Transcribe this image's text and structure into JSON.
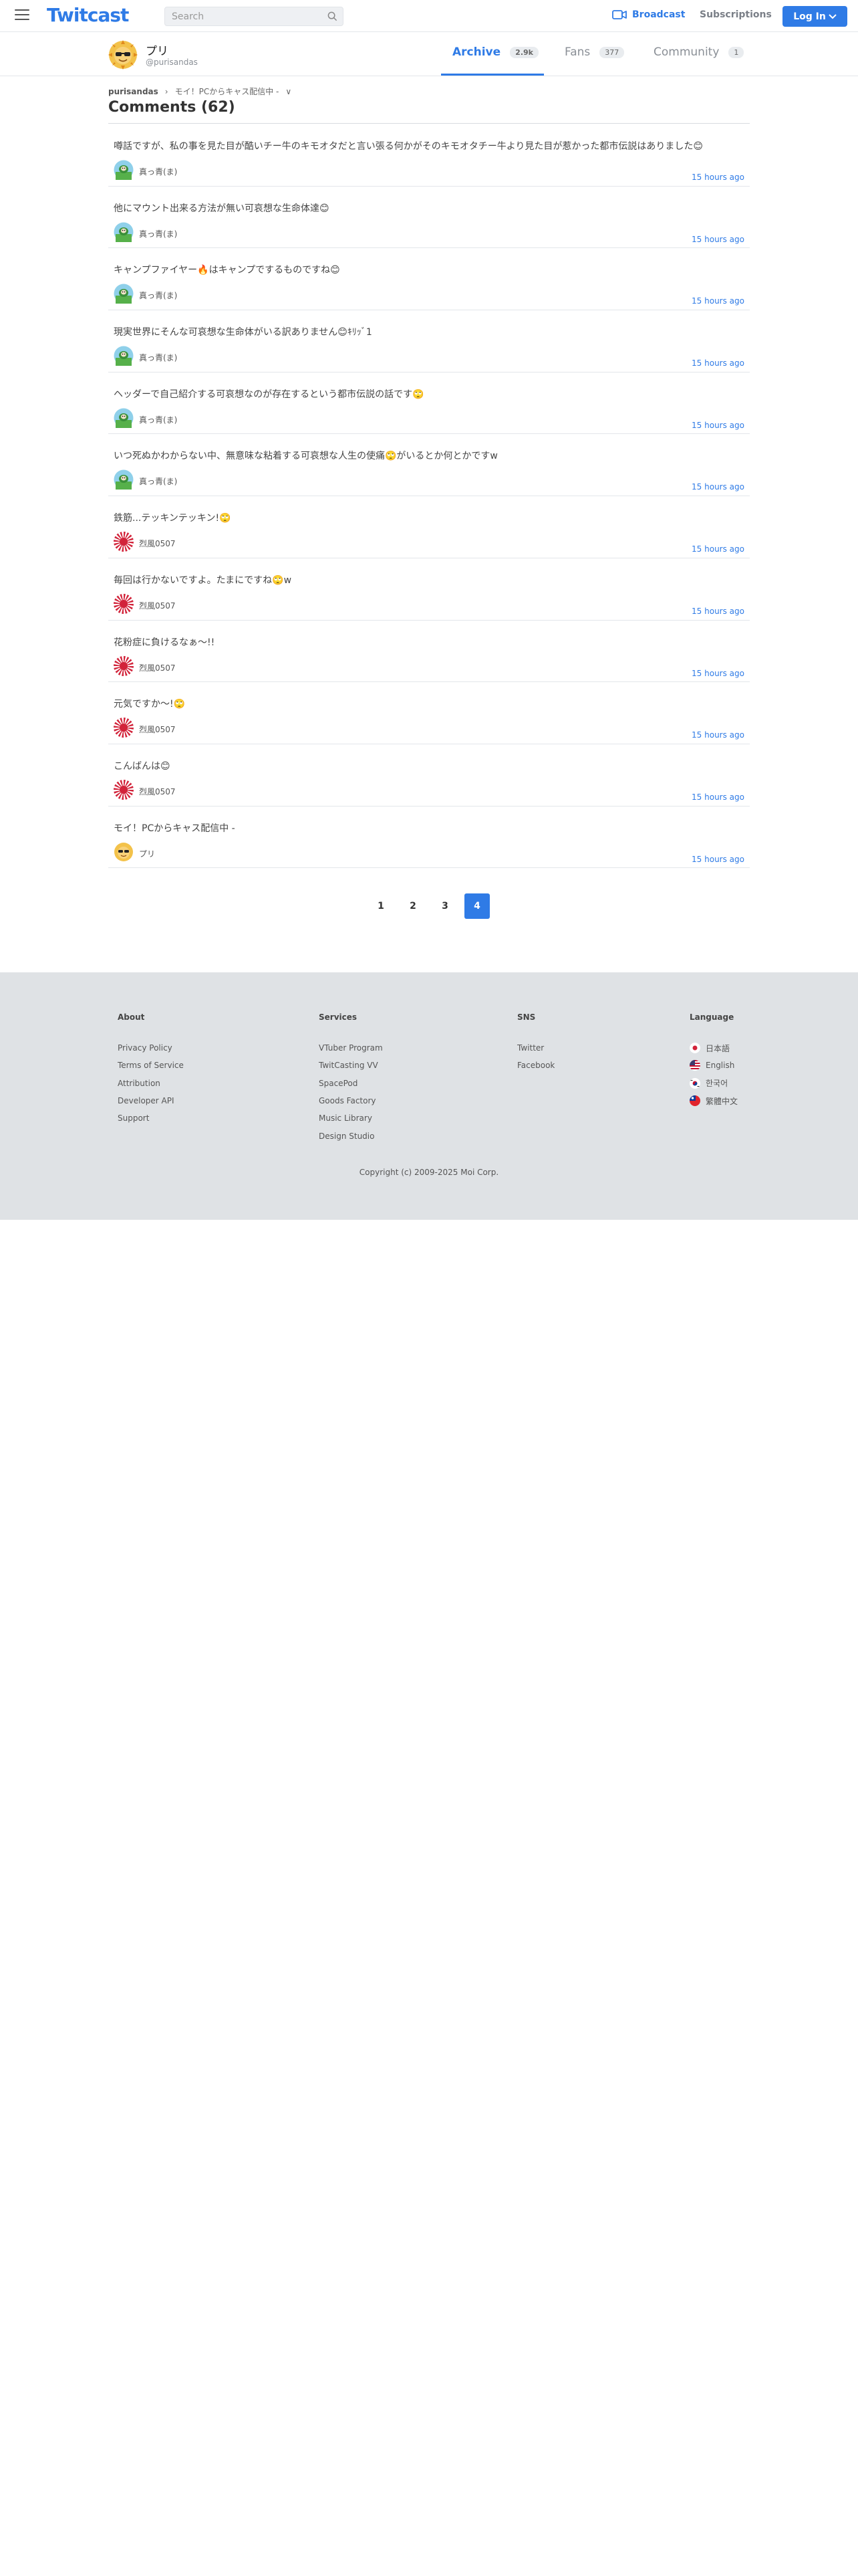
{
  "header": {
    "logo": "Twitcast",
    "search_placeholder": "Search",
    "broadcast_label": "Broadcast",
    "subscriptions_label": "Subscriptions",
    "login_label": "Log In"
  },
  "profile": {
    "name": "プリ",
    "handle": "@purisandas",
    "tabs": [
      {
        "label": "Archive",
        "count": "2.9k"
      },
      {
        "label": "Fans",
        "count": "377"
      },
      {
        "label": "Community",
        "count": "1"
      }
    ]
  },
  "breadcrumb": {
    "user": "purisandas",
    "separator": "›",
    "movie": "モイ！PCからキャス配信中 -",
    "chevron": "∨"
  },
  "page_title": "Comments (62)",
  "comments": [
    {
      "text": "噂話ですが、私の事を見た目が酷いチー牛のキモオタだと言い張る何かがそのキモオタチー牛より見た目が惹かった都市伝説はありました😊",
      "user": "真っ青(ま)",
      "time": "15 hours ago",
      "avatar": "blue"
    },
    {
      "text": "他にマウント出来る方法が無い可哀想な生命体達😊",
      "user": "真っ青(ま)",
      "time": "15 hours ago",
      "avatar": "blue"
    },
    {
      "text": "キャンプファイヤー🔥はキャンプでするものですね😊",
      "user": "真っ青(ま)",
      "time": "15 hours ago",
      "avatar": "blue"
    },
    {
      "text": "現実世界にそんな可哀想な生命体がいる訳ありません😊ｷﾘｯﾞ1",
      "user": "真っ青(ま)",
      "time": "15 hours ago",
      "avatar": "blue"
    },
    {
      "text": "ヘッダーで自己紹介する可哀想なのが存在するという都市伝説の話です🙄",
      "user": "真っ青(ま)",
      "time": "15 hours ago",
      "avatar": "blue"
    },
    {
      "text": "いつ死ぬかわからない中、無意味な粘着する可哀想な人生の使痛🙄がいるとか何とかですw",
      "user": "真っ青(ま)",
      "time": "15 hours ago",
      "avatar": "blue"
    },
    {
      "text": "鉄筋...テッキンテッキン!🙄",
      "user": "烈風0507",
      "time": "15 hours ago",
      "avatar": "red"
    },
    {
      "text": "毎回は行かないですよ。たまにですね🙄w",
      "user": "烈風0507",
      "time": "15 hours ago",
      "avatar": "red"
    },
    {
      "text": "花粉症に負けるなぁ〜!!",
      "user": "烈風0507",
      "time": "15 hours ago",
      "avatar": "red"
    },
    {
      "text": "元気ですか〜!🙄",
      "user": "烈風0507",
      "time": "15 hours ago",
      "avatar": "red"
    },
    {
      "text": "こんばんは😊",
      "user": "烈風0507",
      "time": "15 hours ago",
      "avatar": "red"
    },
    {
      "text": "モイ！PCからキャス配信中 -",
      "user": "プリ",
      "time": "15 hours ago",
      "avatar": "puri"
    }
  ],
  "pagination": [
    "1",
    "2",
    "3",
    "4"
  ],
  "footer": {
    "about": {
      "title": "About",
      "links": [
        "Privacy Policy",
        "Terms of Service",
        "Attribution",
        "Developer API",
        "Support"
      ]
    },
    "services": {
      "title": "Services",
      "links": [
        "VTuber Program",
        "TwitCasting VV",
        "SpacePod",
        "Goods Factory",
        "Music Library",
        "Design Studio"
      ]
    },
    "sns": {
      "title": "SNS",
      "links": [
        "Twitter",
        "Facebook"
      ]
    },
    "language": {
      "title": "Language",
      "links": [
        "日本語",
        "English",
        "한국어",
        "繁體中文"
      ]
    },
    "copyright": "Copyright (c) 2009-2025 Moi Corp."
  },
  "colors": {
    "accent": "#2f7be6",
    "footer_bg": "#dfe2e5"
  }
}
